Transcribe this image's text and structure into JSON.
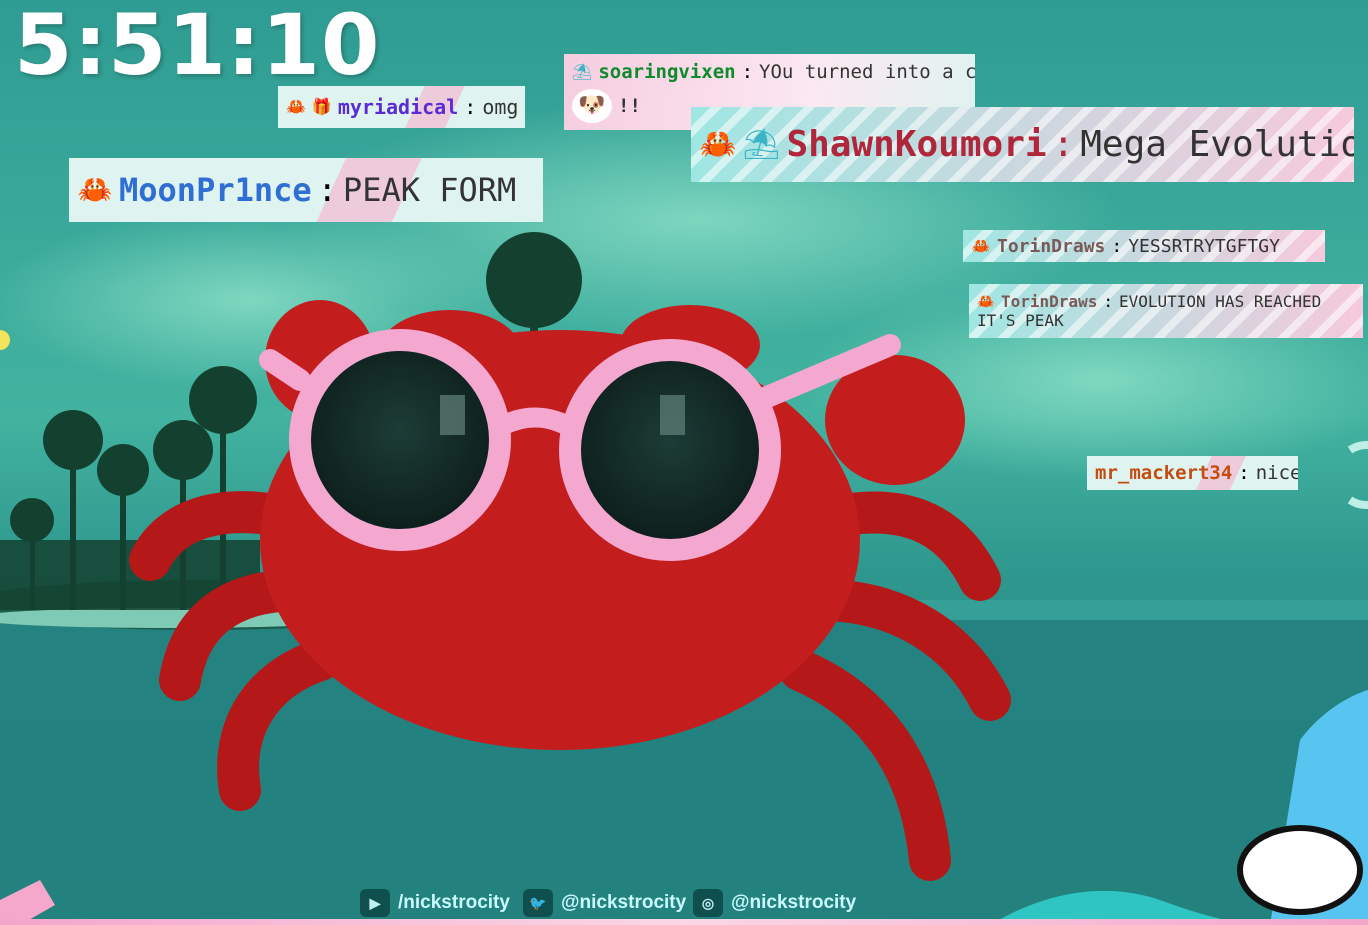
{
  "timer": {
    "value": "5:51:10"
  },
  "chat": [
    {
      "badges": [
        "crab",
        "gift"
      ],
      "username": "myriadical",
      "message": "omg",
      "user_color": "#5a2bd6"
    },
    {
      "badges": [
        "umbrella"
      ],
      "username": "soaringvixen",
      "message": "YOu turned into a crab",
      "line2": "!!",
      "user_color": "#0c8a2c"
    },
    {
      "badges": [
        "crab"
      ],
      "username": "MoonPr1nce",
      "message": "PEAK FORM",
      "user_color": "#2f6fd3"
    },
    {
      "badges": [
        "purple-crab",
        "umbrella"
      ],
      "username": "ShawnKoumori",
      "message": "Mega Evolution",
      "user_color": "#b0273b"
    },
    {
      "badges": [
        "crab"
      ],
      "username": "TorinDraws",
      "message": "YESSRTRYTGFTGY",
      "user_color": "#7a5a58"
    },
    {
      "badges": [
        "crab"
      ],
      "username": "TorinDraws",
      "message": "EVOLUTION HAS REACHED",
      "line2": "IT'S PEAK",
      "user_color": "#7a5a58"
    },
    {
      "badges": [],
      "username": "mr_mackert34",
      "message": "nice",
      "user_color": "#c44d10"
    }
  ],
  "socials": [
    {
      "icon": "youtube-icon",
      "handle": "/nickstrocity"
    },
    {
      "icon": "twitter-icon",
      "handle": "@nickstrocity"
    },
    {
      "icon": "instagram-icon",
      "handle": "@nickstrocity"
    }
  ],
  "colors": {
    "sea": "#2a8b88",
    "crab": "#c81e1e",
    "glasses": "#f3a9d0",
    "chat_bg": "#dff3f0",
    "accent_pink": "#f2a6c9"
  }
}
